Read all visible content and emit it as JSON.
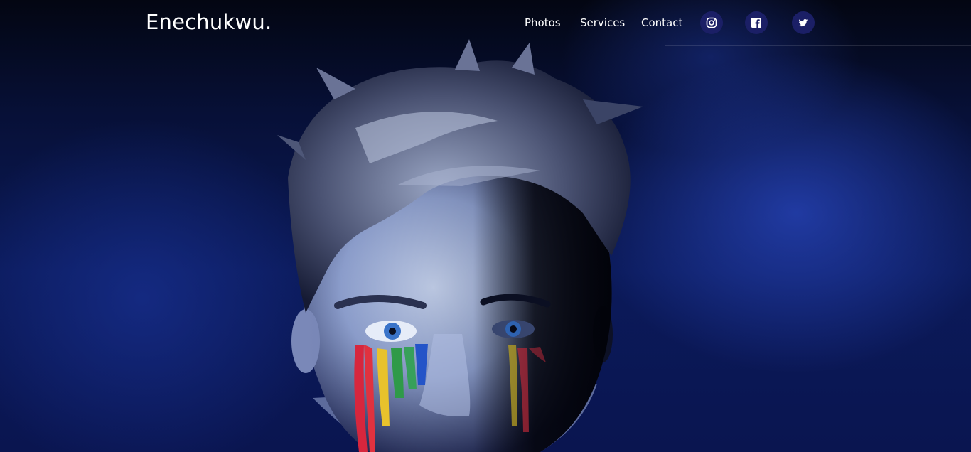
{
  "brand": {
    "name": "Enechukwu."
  },
  "nav": {
    "links": [
      {
        "label": "Photos"
      },
      {
        "label": "Services"
      },
      {
        "label": "Contact"
      }
    ],
    "social": [
      {
        "icon": "instagram-icon"
      },
      {
        "icon": "facebook-icon"
      },
      {
        "icon": "twitter-icon"
      }
    ]
  },
  "hero": {
    "image": "portrait of a young man with rainbow paint dripping from his eyes against blue smoke"
  },
  "colors": {
    "background": "#05081c",
    "smoke": "#1a3aa8",
    "icon_circle": "#1b1f66",
    "text": "#ffffff"
  }
}
